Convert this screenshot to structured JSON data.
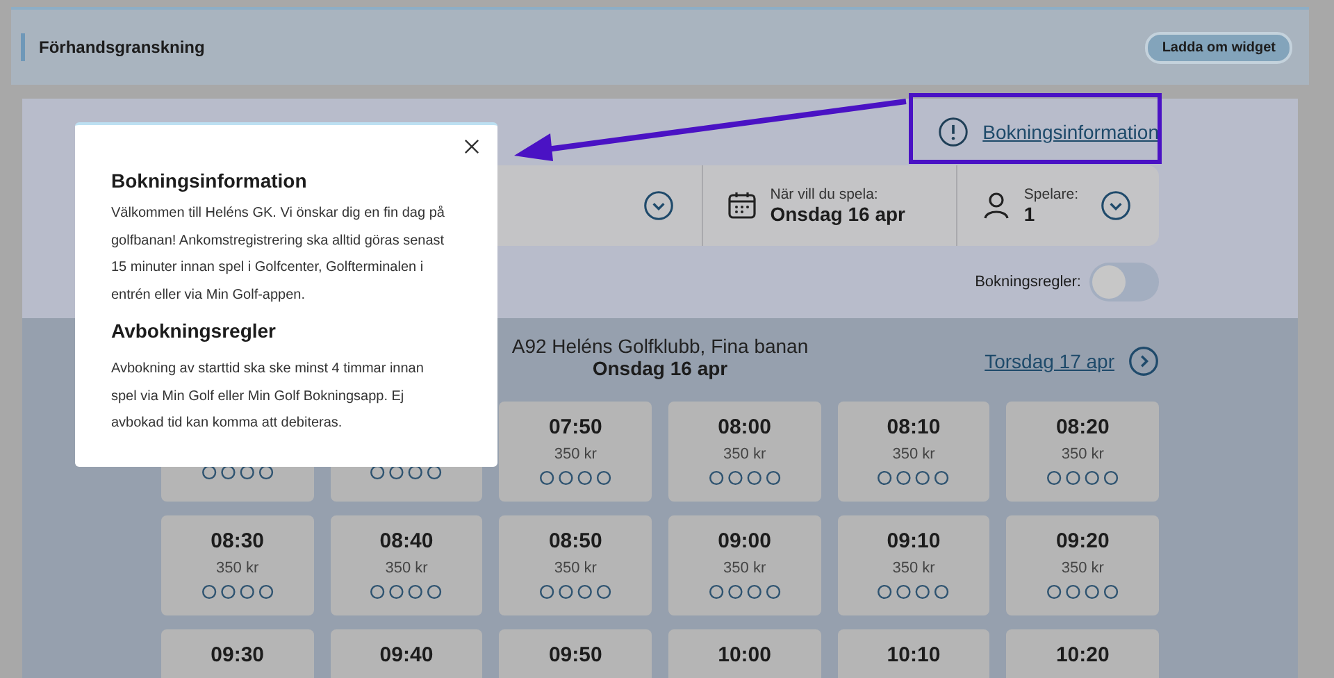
{
  "header": {
    "title": "Förhandsgranskning",
    "reload_button": "Ladda om widget"
  },
  "info_link": "Bokningsinformation",
  "filters": [
    {
      "kind": "select"
    },
    {
      "kind": "date",
      "label": "När vill du spela:",
      "value": "Onsdag 16 apr"
    },
    {
      "kind": "players",
      "label": "Spelare:",
      "value": "1"
    }
  ],
  "booking_rules_toggle": {
    "label": "Bokningsregler:",
    "on": false
  },
  "schedule": {
    "course": "A92 Heléns Golfklubb, Fina banan",
    "date": "Onsdag 16 apr",
    "next_day": "Torsdag 17 apr",
    "slots": [
      {
        "covered": true
      },
      {
        "covered": true
      },
      {
        "time": "07:50",
        "price": "350 kr"
      },
      {
        "time": "08:00",
        "price": "350 kr"
      },
      {
        "time": "08:10",
        "price": "350 kr"
      },
      {
        "time": "08:20",
        "price": "350 kr"
      },
      {
        "time": "08:30",
        "price": "350 kr"
      },
      {
        "time": "08:40",
        "price": "350 kr"
      },
      {
        "time": "08:50",
        "price": "350 kr"
      },
      {
        "time": "09:00",
        "price": "350 kr"
      },
      {
        "time": "09:10",
        "price": "350 kr"
      },
      {
        "time": "09:20",
        "price": "350 kr"
      },
      {
        "time": "09:30"
      },
      {
        "time": "09:40"
      },
      {
        "time": "09:50"
      },
      {
        "time": "10:00"
      },
      {
        "time": "10:10"
      },
      {
        "time": "10:20"
      }
    ]
  },
  "modal": {
    "title": "Bokningsinformation",
    "text": "Välkommen till Heléns GK. Vi önskar dig en fin dag på golfbanan! Ankomstregistrering ska alltid göras senast 15 minuter innan spel i Golfcenter, Golfterminalen i entrén eller via Min Golf-appen.",
    "section_title": "Avbokningsregler",
    "section_text": "Avbokning av starttid ska ske minst 4 timmar innan spel via Min Golf eller Min Golf Bokningsapp. Ej avbokad tid kan komma att debiteras."
  }
}
